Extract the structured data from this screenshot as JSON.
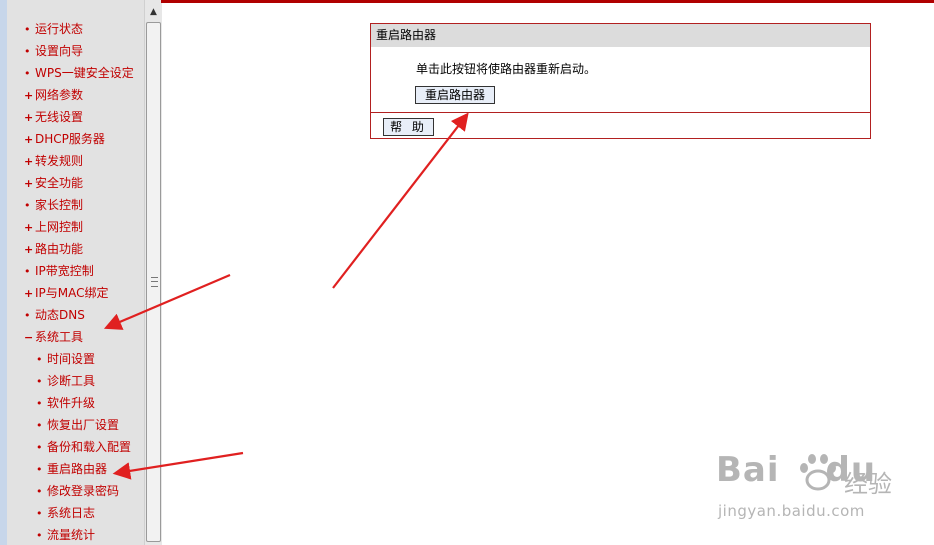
{
  "sidebar": {
    "items": [
      {
        "marker": "•",
        "label": "运行状态",
        "sub": false
      },
      {
        "marker": "•",
        "label": "设置向导",
        "sub": false
      },
      {
        "marker": "•",
        "label": "WPS一键安全设定",
        "sub": false
      },
      {
        "marker": "+",
        "label": "网络参数",
        "sub": false
      },
      {
        "marker": "+",
        "label": "无线设置",
        "sub": false
      },
      {
        "marker": "+",
        "label": "DHCP服务器",
        "sub": false
      },
      {
        "marker": "+",
        "label": "转发规则",
        "sub": false
      },
      {
        "marker": "+",
        "label": "安全功能",
        "sub": false
      },
      {
        "marker": "•",
        "label": "家长控制",
        "sub": false
      },
      {
        "marker": "+",
        "label": "上网控制",
        "sub": false
      },
      {
        "marker": "+",
        "label": "路由功能",
        "sub": false
      },
      {
        "marker": "•",
        "label": "IP带宽控制",
        "sub": false
      },
      {
        "marker": "+",
        "label": "IP与MAC绑定",
        "sub": false
      },
      {
        "marker": "•",
        "label": "动态DNS",
        "sub": false
      },
      {
        "marker": "−",
        "label": "系统工具",
        "sub": false
      },
      {
        "marker": "•",
        "label": "时间设置",
        "sub": true
      },
      {
        "marker": "•",
        "label": "诊断工具",
        "sub": true
      },
      {
        "marker": "•",
        "label": "软件升级",
        "sub": true
      },
      {
        "marker": "•",
        "label": "恢复出厂设置",
        "sub": true
      },
      {
        "marker": "•",
        "label": "备份和载入配置",
        "sub": true
      },
      {
        "marker": "•",
        "label": "重启路由器",
        "sub": true
      },
      {
        "marker": "•",
        "label": "修改登录密码",
        "sub": true
      },
      {
        "marker": "•",
        "label": "系统日志",
        "sub": true
      },
      {
        "marker": "•",
        "label": "流量统计",
        "sub": true
      }
    ]
  },
  "panel": {
    "title": "重启路由器",
    "description": "单击此按钮将使路由器重新启动。",
    "reboot_button": "重启路由器",
    "help_button": "帮 助"
  },
  "watermark": {
    "brand": "Bai",
    "brand2": "du",
    "cn": "经验",
    "url": "jingyan.baidu.com"
  },
  "colors": {
    "menu_text": "#c10000",
    "sidebar_bg": "#e2e2e2",
    "panel_border": "#b22020",
    "annotation_arrow": "#e02020"
  }
}
